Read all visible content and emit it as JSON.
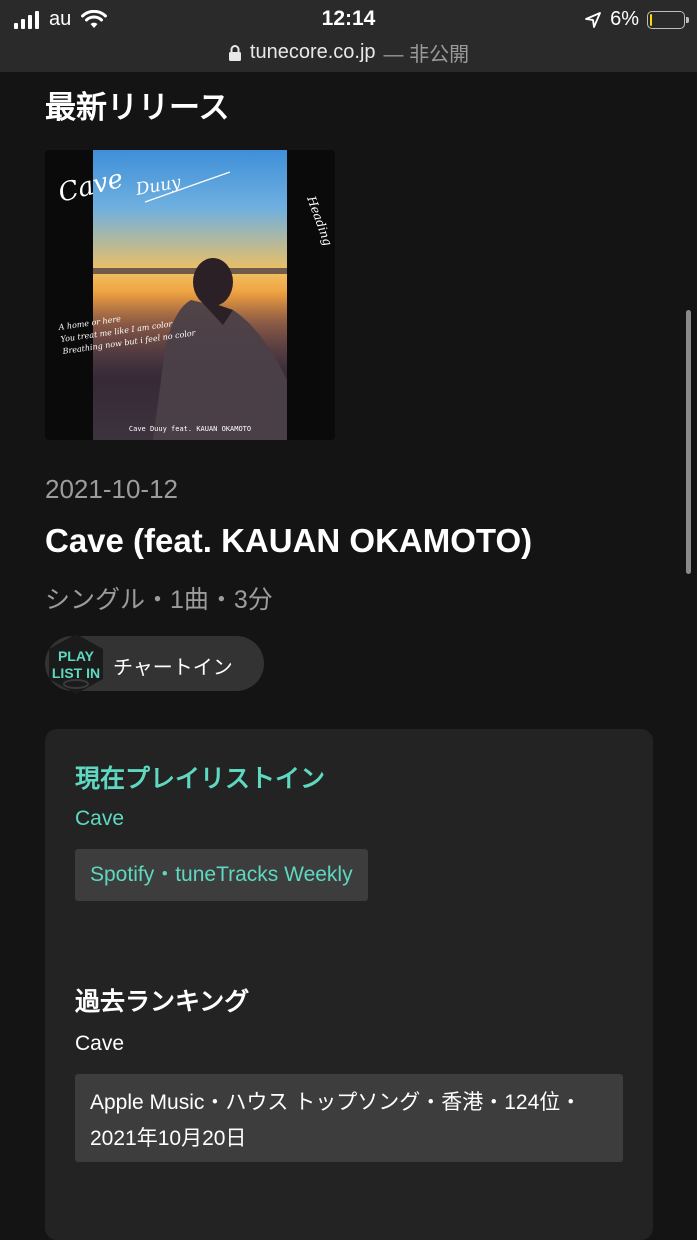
{
  "status_bar": {
    "carrier": "au",
    "time": "12:14",
    "battery_percent": "6%",
    "battery_level": 0.06,
    "url_domain": "tunecore.co.jp",
    "url_suffix": "— 非公開"
  },
  "section_title": "最新リリース",
  "release": {
    "cover": {
      "script_title": "Cave",
      "script_artist": "Duuy",
      "side_text": "Heading",
      "lyric_line_1": "A home or here",
      "lyric_line_2": "You treat me like I am color",
      "lyric_line_3": "Breathing now but i feel no color",
      "caption": "Cave Duuy feat. KAUAN OKAMOTO"
    },
    "date": "2021-10-12",
    "title": "Cave (feat. KAUAN OKAMOTO)",
    "meta": "シングル・1曲・3分"
  },
  "chart_in": {
    "badge_line_1": "PLAY",
    "badge_line_2": "LIST IN",
    "label": "チャートイン"
  },
  "current_playlist": {
    "heading": "現在プレイリストイン",
    "song": "Cave",
    "entry": "Spotify・tuneTracks Weekly"
  },
  "past_ranking": {
    "heading": "過去ランキング",
    "song": "Cave",
    "entry_line_1": "Apple Music・ハウス トップソング・香港・124位・",
    "entry_line_2": "2021年10月20日"
  },
  "colors": {
    "accent": "#5ed8c0",
    "background": "#141414",
    "card": "#232323"
  }
}
